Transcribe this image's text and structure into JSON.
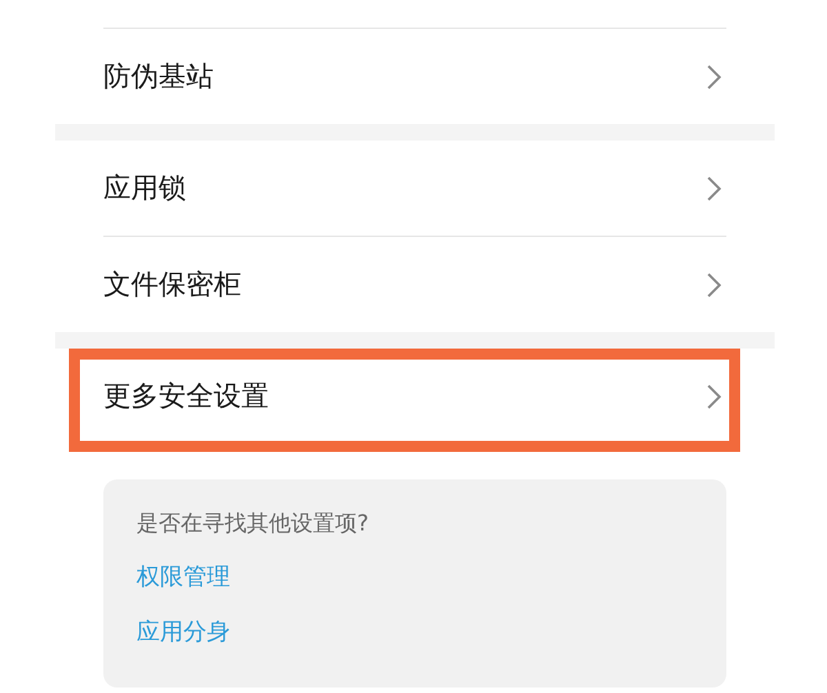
{
  "groups": [
    {
      "items": [
        {
          "label": "防伪基站",
          "highlighted": false
        }
      ]
    },
    {
      "items": [
        {
          "label": "应用锁",
          "highlighted": false
        },
        {
          "label": "文件保密柜",
          "highlighted": false
        }
      ]
    },
    {
      "items": [
        {
          "label": "更多安全设置",
          "highlighted": true
        }
      ]
    }
  ],
  "suggestion": {
    "prompt": "是否在寻找其他设置项?",
    "links": [
      "权限管理",
      "应用分身"
    ]
  }
}
